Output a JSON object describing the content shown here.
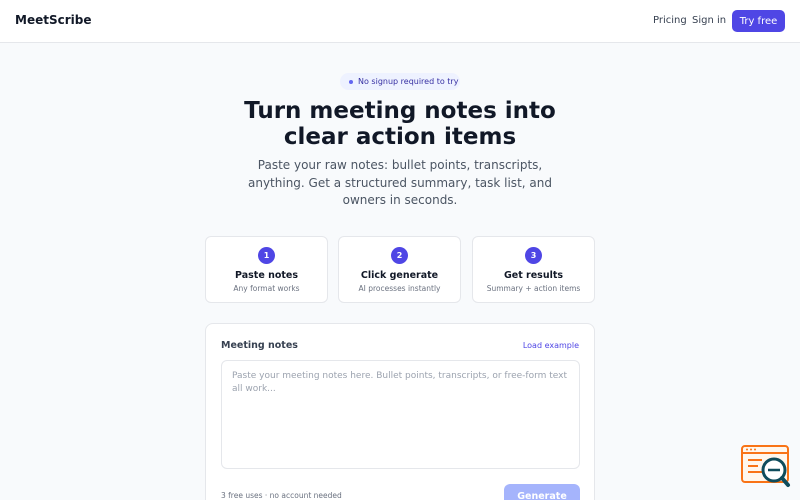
{
  "header": {
    "brand": "MeetScribe",
    "nav": {
      "pricing": "Pricing",
      "sign_in": "Sign in"
    },
    "cta": "Try free"
  },
  "hero": {
    "badge": "No signup required to try",
    "title_line1": "Turn meeting notes into",
    "title_line2": "clear action items",
    "subtitle_line1": "Paste your raw notes: bullet points, transcripts,",
    "subtitle_line2": "anything. Get a structured summary, task list, and",
    "subtitle_line3": "owners in seconds."
  },
  "steps": [
    {
      "num": "1",
      "title": "Paste notes",
      "desc": "Any format works"
    },
    {
      "num": "2",
      "title": "Click generate",
      "desc": "AI processes instantly"
    },
    {
      "num": "3",
      "title": "Get results",
      "desc": "Summary + action items"
    }
  ],
  "notes_card": {
    "label": "Meeting notes",
    "load_example": "Load example",
    "value": "",
    "placeholder": "Paste your meeting notes here. Bullet points, transcripts, or free-form text all work...",
    "uses_note": "3 free uses · no account needed",
    "generate": "Generate"
  },
  "colors": {
    "accent": "#4f46e5",
    "accent_disabled": "#a5b4fc",
    "background": "#f8fafc",
    "widget_orange": "#f97316",
    "widget_teal": "#0f4c5c"
  },
  "icons": {
    "widget": "search-document-icon"
  }
}
